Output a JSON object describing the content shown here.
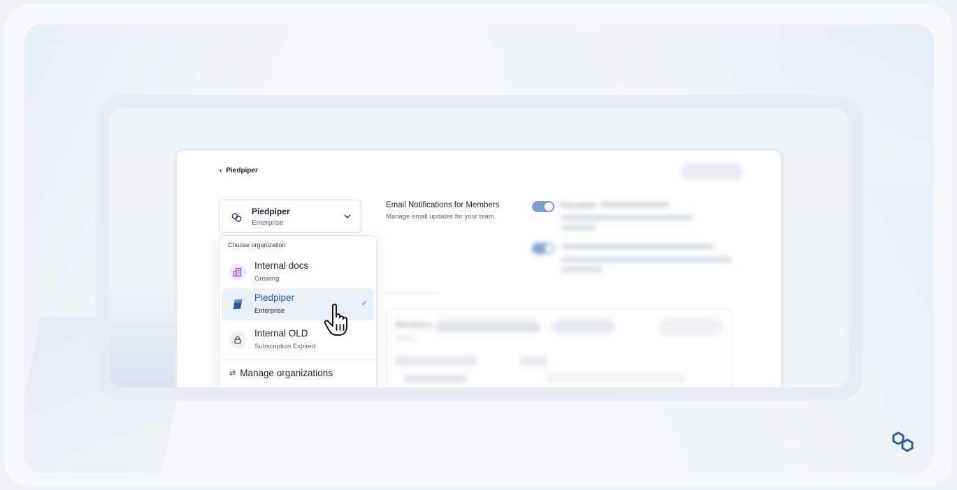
{
  "breadcrumb": {
    "back_label": "Piedpiper"
  },
  "org_selector": {
    "selected_name": "Piedpiper",
    "selected_tier": "Enterprise"
  },
  "dropdown": {
    "header": "Choose organization",
    "items": [
      {
        "name": "Internal docs",
        "subtitle": "Growing",
        "icon": "building-icon",
        "selected": false
      },
      {
        "name": "Piedpiper",
        "subtitle": "Enterprise",
        "icon": "cube-icon",
        "selected": true
      },
      {
        "name": "Internal OLD",
        "subtitle": "Subscription Expired",
        "icon": "lock-icon",
        "selected": false
      }
    ],
    "manage_label": "Manage organizations"
  },
  "notifications": {
    "title": "Email Notifications for Members",
    "subtitle": "Manage email updates for your team.",
    "pref_1_title": "Document"
  },
  "members": {
    "title": "Members"
  },
  "colors": {
    "accent": "#2b5697",
    "selected_bg": "#eaf0f8",
    "toggle_on": "#7f9fcb",
    "brand": "#2f5fa3"
  }
}
